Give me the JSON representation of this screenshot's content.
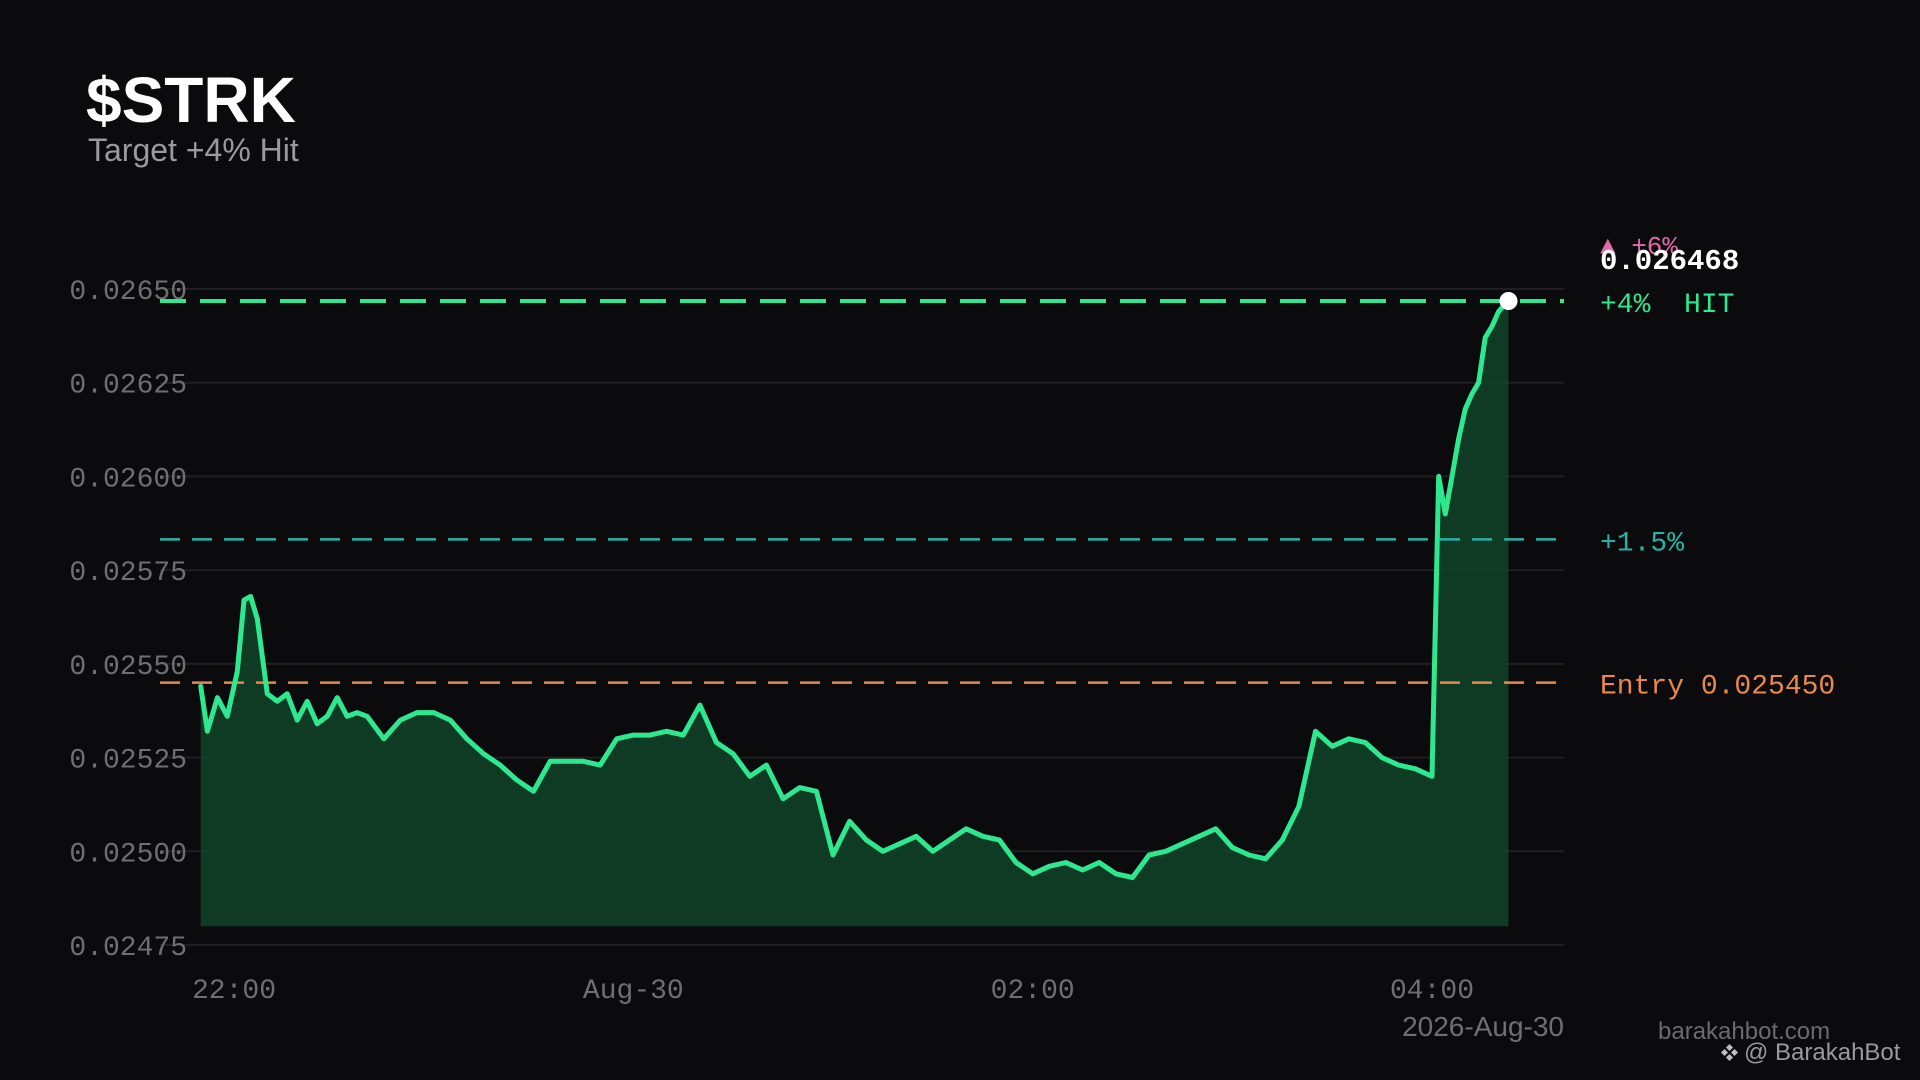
{
  "title": "$STRK",
  "subtitle": "Target +4% Hit",
  "watermark": {
    "site": "barakahbot.com",
    "handle": "@ BarakahBot",
    "icon": "diamond-icon"
  },
  "colors": {
    "background": "#0b0b0d",
    "price_line": "#2ee88f",
    "area_fill": "#10442a",
    "target_hit": "#2ee88f",
    "target_mid": "#27b3a3",
    "entry": "#e8894a",
    "top_target": "#e06aa8",
    "grid": "#1f1f22",
    "axis_text": "#6f6f6f"
  },
  "chart_data": {
    "type": "line",
    "ylim": [
      0.02462,
      0.02664
    ],
    "y_ticks": [
      "0.02475",
      "0.02500",
      "0.02525",
      "0.02550",
      "0.02575",
      "0.02600",
      "0.02625",
      "0.02650"
    ],
    "x_ticks": [
      "22:00",
      "Aug-30",
      "02:00",
      "04:00"
    ],
    "date_label": "2026-Aug-30",
    "grid": true,
    "levels": [
      {
        "label": "+4%  HIT",
        "value": 0.026468,
        "style": "dashed-thick",
        "color": "#2ee88f"
      },
      {
        "label": "+1.5%",
        "value": 0.025832,
        "style": "dashed",
        "color": "#27b3a3"
      },
      {
        "label": "Entry 0.025450",
        "value": 0.02545,
        "style": "dashed",
        "color": "#e8894a"
      }
    ],
    "top_target_label": "▲ +6%",
    "current_price_label": "0.026468",
    "x_range": [
      "21:50",
      "04:23"
    ],
    "series": [
      {
        "x": [
          "21:50",
          "21:52",
          "21:55",
          "21:58",
          "22:01",
          "22:03",
          "22:05",
          "22:07",
          "22:10",
          "22:13",
          "22:16",
          "22:19",
          "22:22",
          "22:25",
          "22:28",
          "22:31",
          "22:34",
          "22:37",
          "22:40",
          "22:45",
          "22:50",
          "22:55",
          "23:00",
          "23:05",
          "23:10",
          "23:15",
          "23:20",
          "23:25",
          "23:30",
          "23:35",
          "23:40",
          "23:45",
          "23:50",
          "23:55",
          "00:00",
          "00:05",
          "00:10",
          "00:15",
          "00:20",
          "00:25",
          "00:30",
          "00:35",
          "00:40",
          "00:45",
          "00:50",
          "00:55",
          "01:00",
          "01:05",
          "01:10",
          "01:15",
          "01:20",
          "01:25",
          "01:30",
          "01:35",
          "01:40",
          "01:45",
          "01:50",
          "01:55",
          "02:00",
          "02:05",
          "02:10",
          "02:15",
          "02:20",
          "02:25",
          "02:30",
          "02:35",
          "02:40",
          "02:45",
          "02:50",
          "02:55",
          "03:00",
          "03:05",
          "03:10",
          "03:15",
          "03:20",
          "03:25",
          "03:30",
          "03:35",
          "03:40",
          "03:45",
          "03:50",
          "03:55",
          "04:00",
          "04:02",
          "04:04",
          "04:06",
          "04:08",
          "04:10",
          "04:12",
          "04:14",
          "04:16",
          "04:18",
          "04:20",
          "04:22",
          "04:23"
        ],
        "y": [
          0.02544,
          0.02532,
          0.02541,
          0.02536,
          0.02548,
          0.02567,
          0.02568,
          0.02562,
          0.02542,
          0.0254,
          0.02542,
          0.02535,
          0.0254,
          0.02534,
          0.02536,
          0.02541,
          0.02536,
          0.02537,
          0.02536,
          0.0253,
          0.02535,
          0.02537,
          0.02537,
          0.02535,
          0.0253,
          0.02526,
          0.02523,
          0.02519,
          0.02516,
          0.02524,
          0.02524,
          0.02524,
          0.02523,
          0.0253,
          0.02531,
          0.02531,
          0.02532,
          0.02531,
          0.02539,
          0.02529,
          0.02526,
          0.0252,
          0.02523,
          0.02514,
          0.02517,
          0.02516,
          0.02499,
          0.02508,
          0.02503,
          0.025,
          0.02502,
          0.02504,
          0.025,
          0.02503,
          0.02506,
          0.02504,
          0.02503,
          0.02497,
          0.02494,
          0.02496,
          0.02497,
          0.02495,
          0.02497,
          0.02494,
          0.02493,
          0.02499,
          0.025,
          0.02502,
          0.02504,
          0.02506,
          0.02501,
          0.02499,
          0.02498,
          0.02503,
          0.02512,
          0.02532,
          0.02528,
          0.0253,
          0.02529,
          0.02525,
          0.02523,
          0.02522,
          0.0252,
          0.026,
          0.0259,
          0.026,
          0.0261,
          0.02618,
          0.02622,
          0.02625,
          0.02637,
          0.0264,
          0.02644,
          0.02646,
          0.026468
        ]
      }
    ]
  }
}
